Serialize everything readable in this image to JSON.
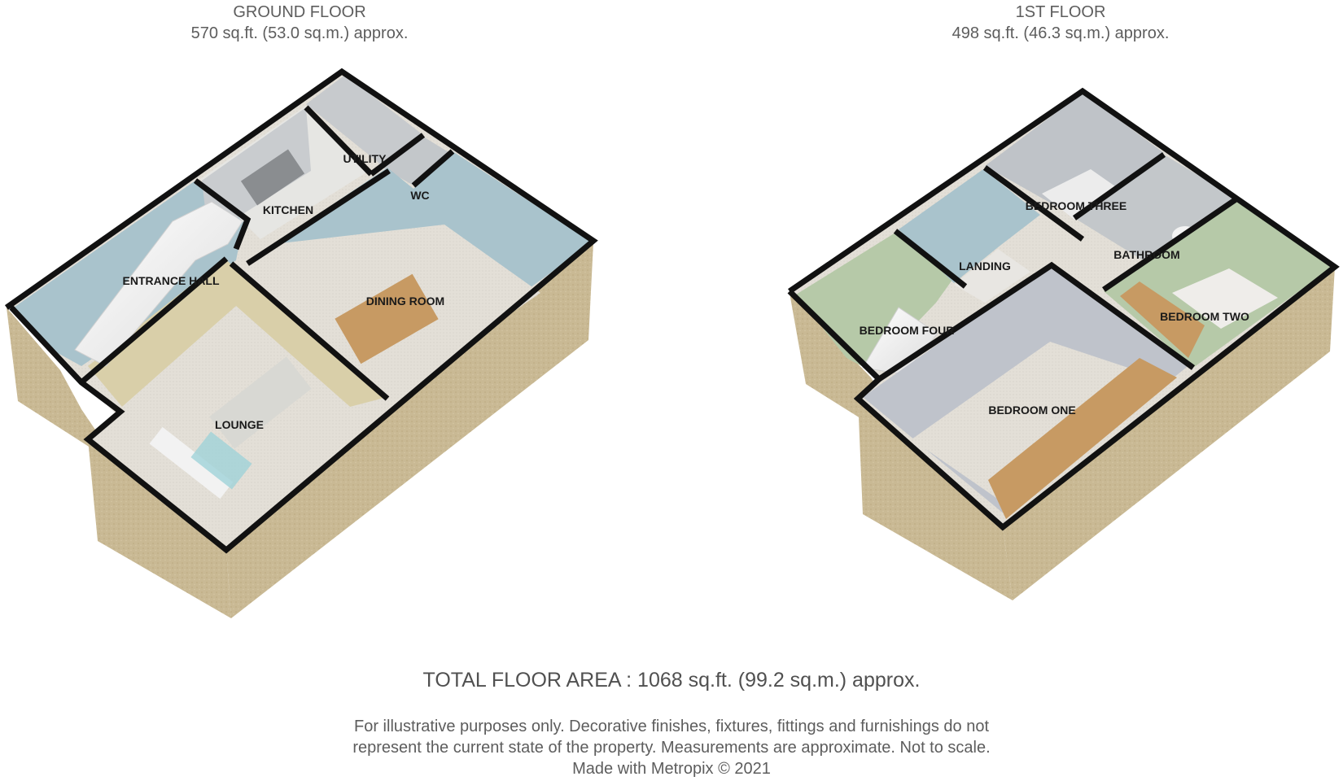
{
  "ground_floor": {
    "title": "GROUND FLOOR",
    "area": "570 sq.ft. (53.0 sq.m.) approx.",
    "rooms": {
      "utility": "UTILITY",
      "kitchen": "KITCHEN",
      "wc": "WC",
      "entrance_hall": "ENTRANCE HALL",
      "dining_room": "DINING ROOM",
      "lounge": "LOUNGE"
    }
  },
  "first_floor": {
    "title": "1ST FLOOR",
    "area": "498 sq.ft. (46.3 sq.m.) approx.",
    "rooms": {
      "bedroom_three": "BEDROOM THREE",
      "landing": "LANDING",
      "bathroom": "BATHROOM",
      "bedroom_four": "BEDROOM FOUR",
      "bedroom_two": "BEDROOM TWO",
      "bedroom_one": "BEDROOM ONE"
    }
  },
  "total_floor_area": "TOTAL FLOOR AREA : 1068 sq.ft. (99.2 sq.m.) approx.",
  "disclaimer": {
    "line1": "For illustrative purposes only. Decorative finishes, fixtures, fittings and furnishings do not",
    "line2": "represent the current state of the property. Measurements are approximate. Not to scale.",
    "line3": "Made with Metropix © 2021"
  },
  "colors": {
    "exterior_wall": "#c9b994",
    "wall_cap": "#111111",
    "blue_wall": "#a9c3cc",
    "grey_wall": "#bfc3c8",
    "green_wall": "#b6c9a8",
    "beige_wall": "#d9cfa9",
    "carpet": "#e2ded6",
    "wood": "#c79a63"
  }
}
